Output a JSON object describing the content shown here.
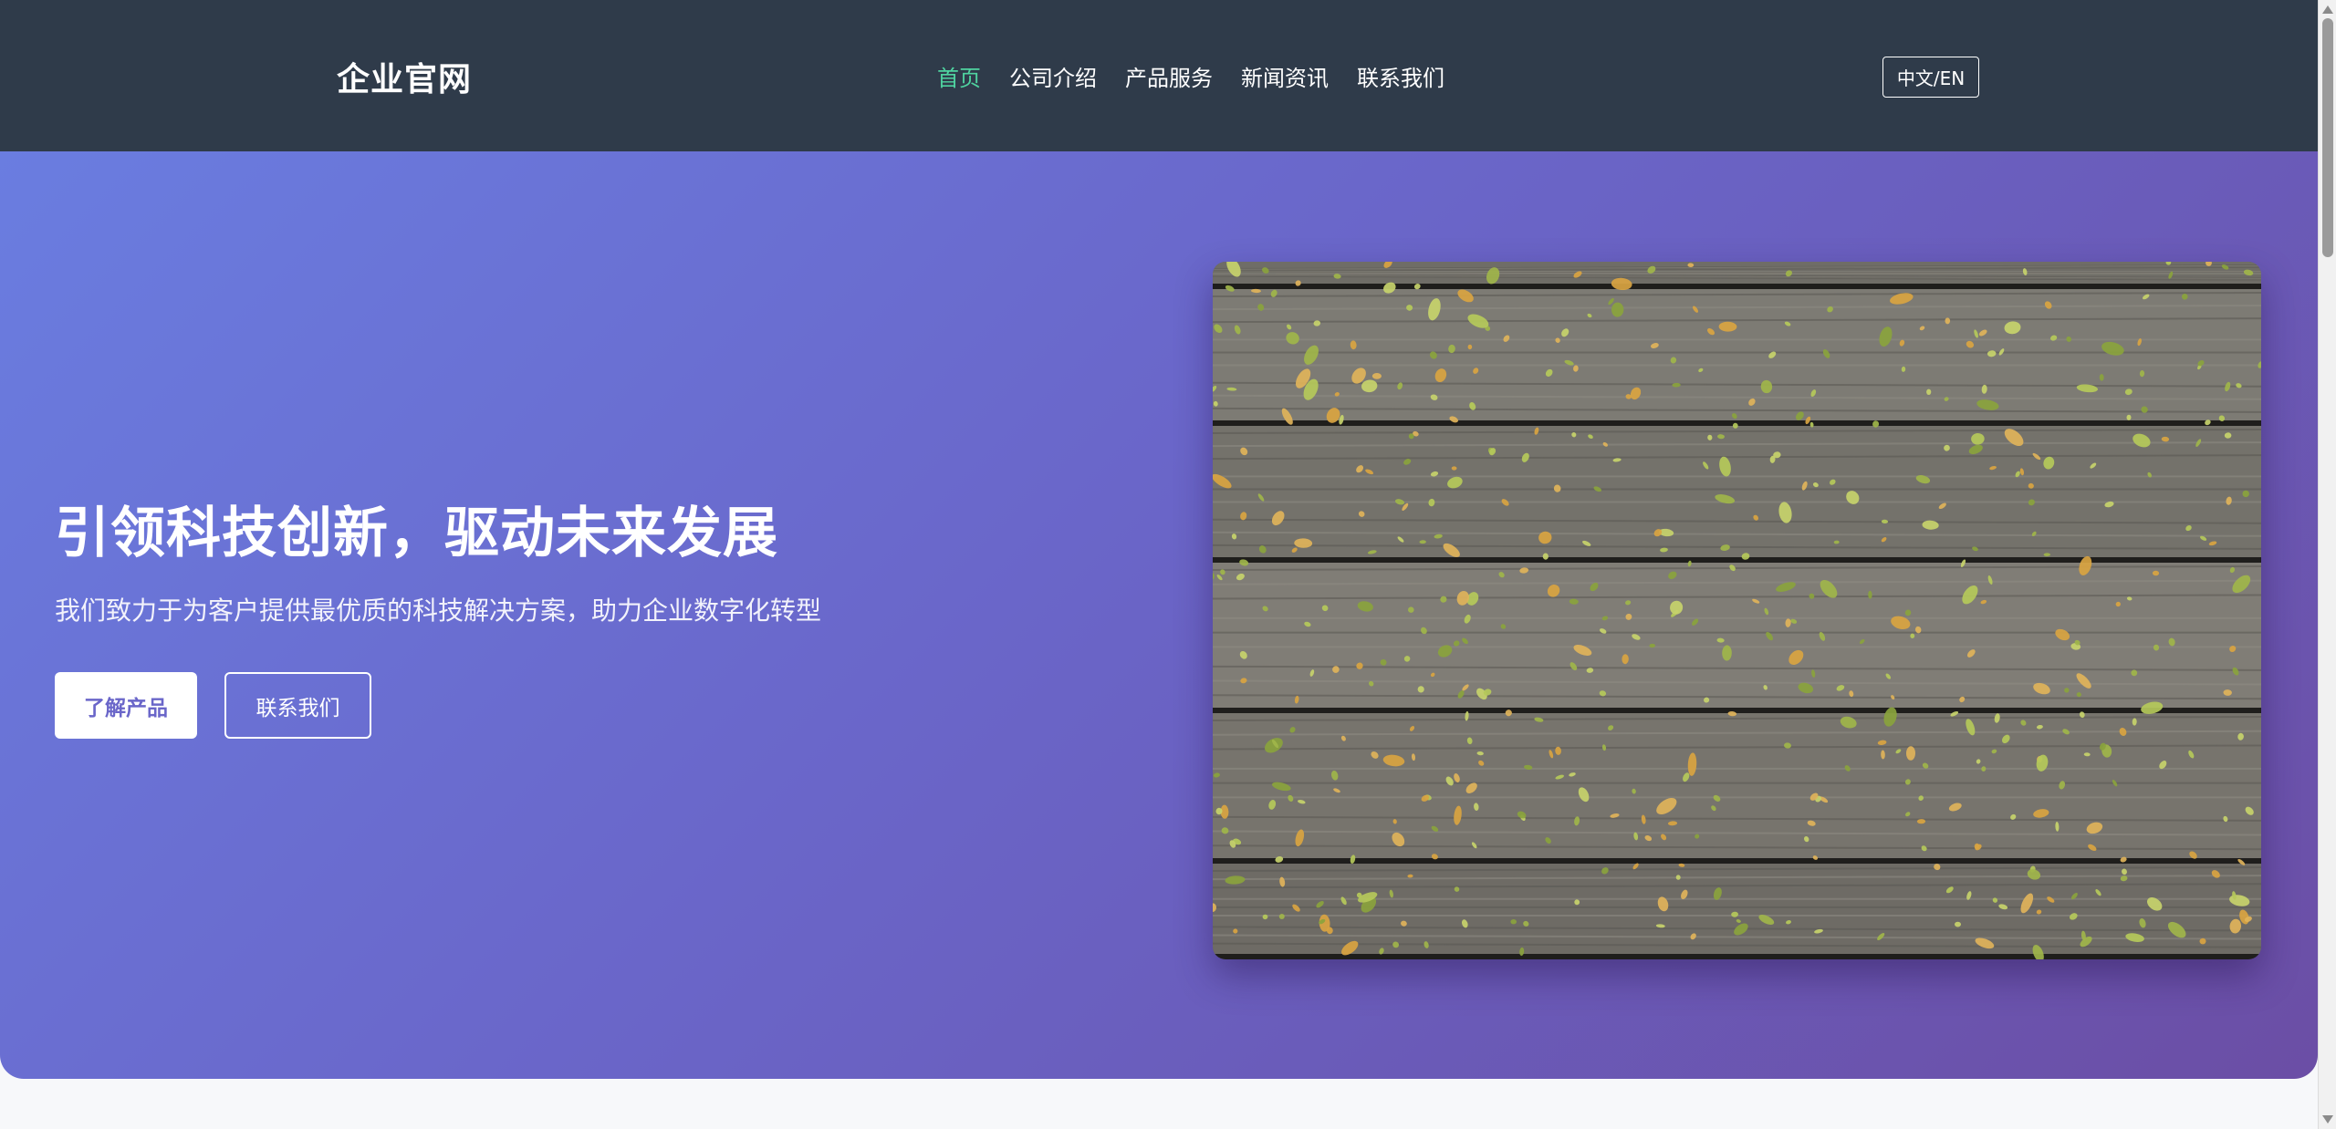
{
  "header": {
    "logo": "企业官网",
    "nav": [
      {
        "label": "首页",
        "active": true
      },
      {
        "label": "公司介绍",
        "active": false
      },
      {
        "label": "产品服务",
        "active": false
      },
      {
        "label": "新闻资讯",
        "active": false
      },
      {
        "label": "联系我们",
        "active": false
      }
    ],
    "lang_toggle": "中文/EN"
  },
  "hero": {
    "title": "引领科技创新，驱动未来发展",
    "subtitle": "我们致力于为客户提供最优质的科技解决方案，助力企业数字化转型",
    "primary_button": "了解产品",
    "secondary_button": "联系我们",
    "image_icon": "wooden-deck-with-leaves-image"
  },
  "colors": {
    "header_bg": "#2f3b4a",
    "nav_active": "#4fd3a0",
    "hero_gradient_start": "#6a7de0",
    "hero_gradient_end": "#6b4ea5",
    "page_bg": "#f7f8fa"
  }
}
